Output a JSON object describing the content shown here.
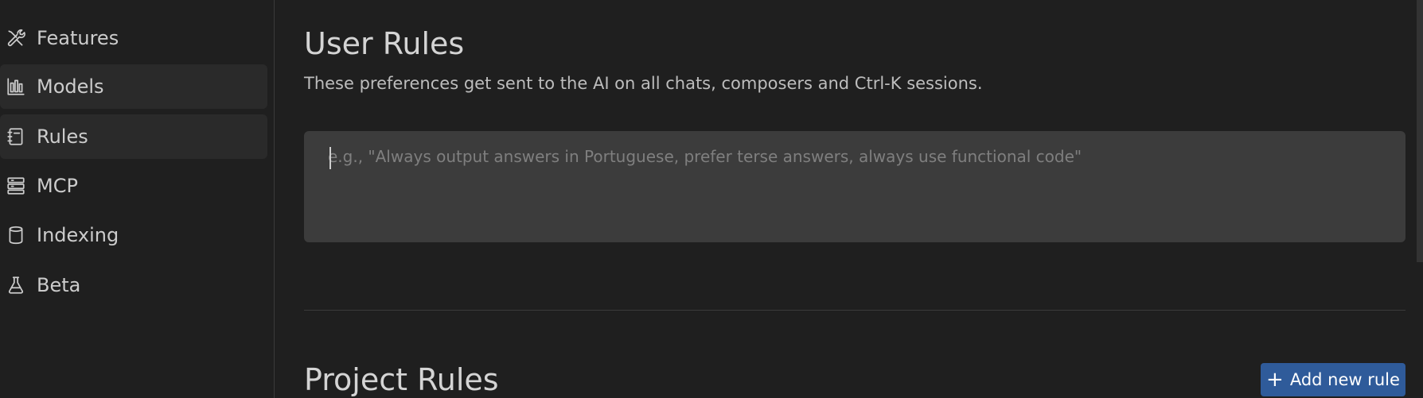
{
  "sidebar": {
    "items": [
      {
        "label": "Features",
        "icon": "tools-icon"
      },
      {
        "label": "Models",
        "icon": "bar-chart-icon"
      },
      {
        "label": "Rules",
        "icon": "notebook-icon"
      },
      {
        "label": "MCP",
        "icon": "server-icon"
      },
      {
        "label": "Indexing",
        "icon": "database-icon"
      },
      {
        "label": "Beta",
        "icon": "flask-icon"
      }
    ]
  },
  "user_rules": {
    "title": "User Rules",
    "description": "These preferences get sent to the AI on all chats, composers and Ctrl-K sessions.",
    "value": "",
    "placeholder": "e.g., \"Always output answers in Portuguese, prefer terse answers, always use functional code\""
  },
  "project_rules": {
    "title": "Project Rules",
    "add_button_label": "Add new rule",
    "add_button_icon": "plus-icon"
  },
  "colors": {
    "background": "#1f1f1f",
    "input_background": "#3c3c3c",
    "accent_button": "#2f5b9a",
    "active_item_background": "#2a2a2a"
  }
}
